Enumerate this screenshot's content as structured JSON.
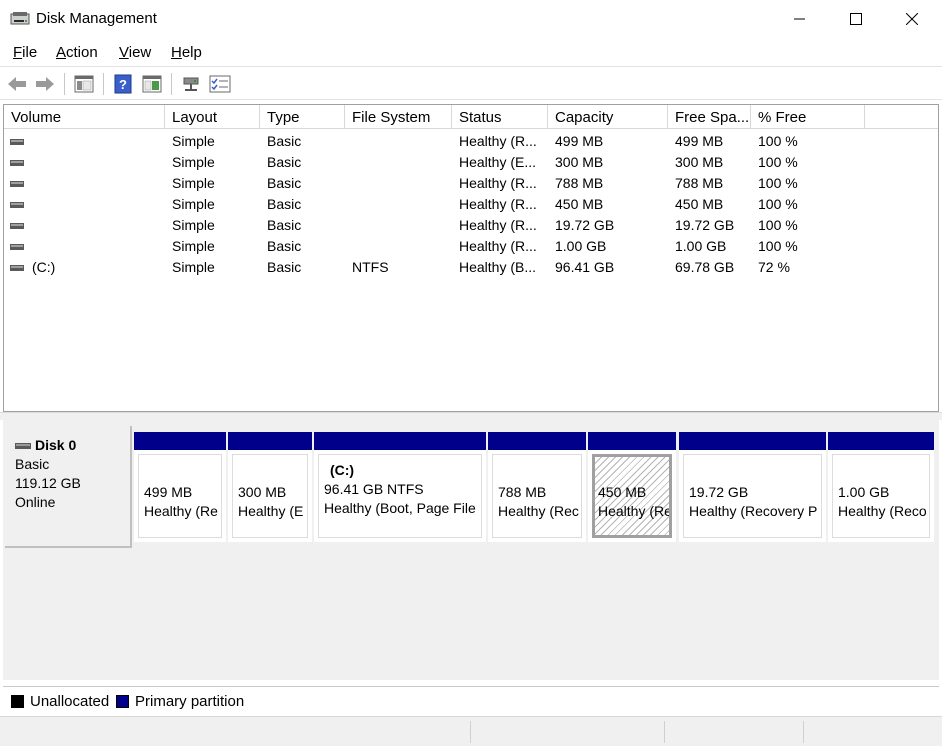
{
  "window": {
    "title": "Disk Management"
  },
  "menu": [
    {
      "label": "File"
    },
    {
      "label": "Action"
    },
    {
      "label": "View"
    },
    {
      "label": "Help"
    }
  ],
  "toolbar": {
    "buttons": [
      "back-arrow-icon",
      "forward-arrow-icon",
      "console-tree-icon",
      "help-icon",
      "properties-icon",
      "connect-icon",
      "checklist-icon"
    ]
  },
  "volume_table": {
    "columns": [
      "Volume",
      "Layout",
      "Type",
      "File System",
      "Status",
      "Capacity",
      "Free Spa...",
      "% Free"
    ],
    "rows": [
      {
        "volume": "",
        "layout": "Simple",
        "type": "Basic",
        "fs": "",
        "status": "Healthy (R...",
        "capacity": "499 MB",
        "free": "499 MB",
        "pct": "100 %"
      },
      {
        "volume": "",
        "layout": "Simple",
        "type": "Basic",
        "fs": "",
        "status": "Healthy (E...",
        "capacity": "300 MB",
        "free": "300 MB",
        "pct": "100 %"
      },
      {
        "volume": "",
        "layout": "Simple",
        "type": "Basic",
        "fs": "",
        "status": "Healthy (R...",
        "capacity": "788 MB",
        "free": "788 MB",
        "pct": "100 %"
      },
      {
        "volume": "",
        "layout": "Simple",
        "type": "Basic",
        "fs": "",
        "status": "Healthy (R...",
        "capacity": "450 MB",
        "free": "450 MB",
        "pct": "100 %"
      },
      {
        "volume": "",
        "layout": "Simple",
        "type": "Basic",
        "fs": "",
        "status": "Healthy (R...",
        "capacity": "19.72 GB",
        "free": "19.72 GB",
        "pct": "100 %"
      },
      {
        "volume": "",
        "layout": "Simple",
        "type": "Basic",
        "fs": "",
        "status": "Healthy (R...",
        "capacity": "1.00 GB",
        "free": "1.00 GB",
        "pct": "100 %"
      },
      {
        "volume": "(C:)",
        "layout": "Simple",
        "type": "Basic",
        "fs": "NTFS",
        "status": "Healthy (B...",
        "capacity": "96.41 GB",
        "free": "69.78 GB",
        "pct": "72 %"
      }
    ]
  },
  "disk": {
    "name": "Disk 0",
    "type": "Basic",
    "size": "119.12 GB",
    "state": "Online",
    "partitions": [
      {
        "label": "",
        "size": "499 MB",
        "status": "Healthy (Re"
      },
      {
        "label": "",
        "size": "300 MB",
        "status": "Healthy (E"
      },
      {
        "label": "(C:)",
        "size": "96.41 GB NTFS",
        "status": "Healthy (Boot, Page File"
      },
      {
        "label": "",
        "size": "788 MB",
        "status": "Healthy (Rec"
      },
      {
        "label": "",
        "size": "450 MB",
        "status": "Healthy (Re"
      },
      {
        "label": "",
        "size": "19.72 GB",
        "status": "Healthy (Recovery P"
      },
      {
        "label": "",
        "size": "1.00 GB",
        "status": "Healthy (Reco"
      }
    ]
  },
  "legend": [
    {
      "label": "Unallocated",
      "color": "#000000"
    },
    {
      "label": "Primary partition",
      "color": "#00008b"
    }
  ],
  "colors": {
    "primary_partition": "#00008b",
    "unallocated": "#000000"
  }
}
